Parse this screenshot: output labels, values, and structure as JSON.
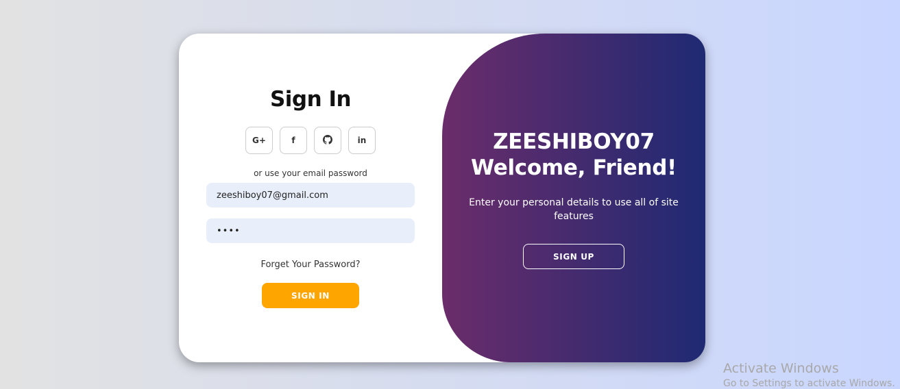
{
  "signin": {
    "title": "Sign In",
    "social": [
      {
        "label": "G+",
        "icon": "google-plus-icon"
      },
      {
        "label": "f",
        "icon": "facebook-icon"
      },
      {
        "label": "",
        "icon": "github-icon"
      },
      {
        "label": "in",
        "icon": "linkedin-icon"
      }
    ],
    "alt_text": "or use your email password",
    "email_value": "zeeshiboy07@gmail.com",
    "password_value": "••••",
    "forgot_label": "Forget Your Password?",
    "button_label": "SIGN IN"
  },
  "toggle": {
    "title_line1": "ZEESHIBOY07",
    "title_line2": "Welcome, Friend!",
    "text": "Enter your personal details to use all of site features",
    "button_label": "SIGN UP"
  },
  "watermark": {
    "title": "Activate Windows",
    "subtitle": "Go to Settings to activate Windows."
  },
  "colors": {
    "accent": "#ffa500",
    "gradient_start": "#6b2c6a",
    "gradient_end": "#1f2a73",
    "input_bg": "#e8eefa"
  }
}
